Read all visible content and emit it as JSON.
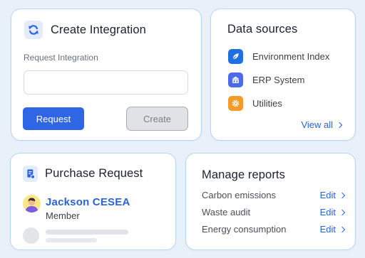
{
  "create_card": {
    "title": "Create Integration",
    "icon": "sync-icon",
    "field_label": "Request Integration",
    "input_value": "",
    "input_placeholder": "",
    "request_label": "Request",
    "create_label": "Create"
  },
  "sources_card": {
    "title": "Data sources",
    "items": [
      {
        "label": "Environment Index",
        "icon": "leaf-icon",
        "color": "#1f6fe0"
      },
      {
        "label": "ERP System",
        "icon": "building-icon",
        "color": "#4d6ae8"
      },
      {
        "label": "Utilities",
        "icon": "gear-icon",
        "color": "#f39a2b"
      }
    ],
    "view_all_label": "View all"
  },
  "purchase_card": {
    "title": "Purchase Request",
    "icon": "document-icon",
    "person_name": "Jackson CESEA",
    "person_role": "Member"
  },
  "reports_card": {
    "title": "Manage reports",
    "rows": [
      {
        "label": "Carbon emissions",
        "action": "Edit"
      },
      {
        "label": "Waste audit",
        "action": "Edit"
      },
      {
        "label": "Energy consumption",
        "action": "Edit"
      }
    ]
  },
  "colors": {
    "accent": "#2f66e6",
    "link": "#2a63d8",
    "card_border": "#b7d6f3",
    "background": "#e8f0fa"
  }
}
